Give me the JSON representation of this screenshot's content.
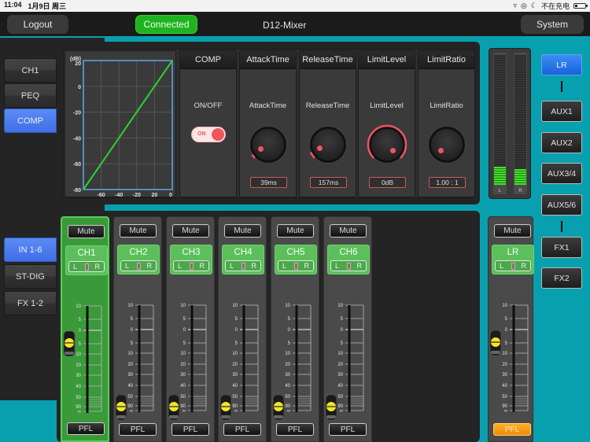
{
  "status_bar": {
    "time": "11:04",
    "date": "1月9日 周三",
    "charging": "不在充电",
    "icons": [
      "wifi-icon",
      "orientation-lock-icon",
      "moon-icon",
      "battery-icon"
    ]
  },
  "header": {
    "logout": "Logout",
    "connection": "Connected",
    "title": "D12-Mixer",
    "system": "System"
  },
  "colors": {
    "accent_teal": "#08a0ae",
    "connected_green": "#1fb41f",
    "active_blue": "#3f6fe5",
    "knob_red": "#f0545f",
    "pfl_orange": "#f08a00"
  },
  "top_tabs": [
    {
      "label": "CH1",
      "active": false
    },
    {
      "label": "PEQ",
      "active": false
    },
    {
      "label": "COMP",
      "active": true
    }
  ],
  "bottom_tabs": [
    {
      "label": "IN 1-6",
      "active": true
    },
    {
      "label": "ST-DIG",
      "active": false
    },
    {
      "label": "FX 1-2",
      "active": false
    }
  ],
  "comp_graph": {
    "unit": "(dB)",
    "y_ticks": [
      "20",
      "0",
      "-20",
      "-40",
      "-60",
      "-80"
    ],
    "x_ticks": [
      "-60",
      "-40",
      "-20",
      "20",
      "0"
    ],
    "curve": "linear-1:1"
  },
  "comp": {
    "header": "COMP",
    "onoff_label": "ON/OFF",
    "toggle_text": "ON",
    "toggle_on": true,
    "params": [
      {
        "header": "AttackTime",
        "label": "AttackTime",
        "value": "39ms",
        "fraction": 0.05
      },
      {
        "header": "ReleaseTime",
        "label": "ReleaseTime",
        "value": "157ms",
        "fraction": 0.08
      },
      {
        "header": "LimitLevel",
        "label": "LimitLevel",
        "value": "0dB",
        "fraction": 1.0
      },
      {
        "header": "LimitRatio",
        "label": "LimitRatio",
        "value": "1.00 : 1",
        "fraction": 0.0
      }
    ]
  },
  "meters": {
    "left_label": "L",
    "right_label": "R",
    "left_level": 0.14,
    "right_level": 0.12
  },
  "buses": [
    {
      "label": "LR",
      "active": true
    },
    {
      "label": "AUX1"
    },
    {
      "label": "AUX2"
    },
    {
      "label": "AUX3/4"
    },
    {
      "label": "AUX5/6"
    },
    {
      "label": "FX1"
    },
    {
      "label": "FX2"
    }
  ],
  "fader_scale": [
    "10",
    "5",
    "0",
    "5",
    "10",
    "20",
    "30",
    "40",
    "50",
    "90",
    "∞"
  ],
  "channels": [
    {
      "name": "CH1",
      "mute": "Mute",
      "pfl": "PFL",
      "pan_l": "L",
      "pan_r": "R",
      "fader_db": "5",
      "selected": true,
      "pfl_on": false
    },
    {
      "name": "CH2",
      "mute": "Mute",
      "pfl": "PFL",
      "pan_l": "L",
      "pan_r": "R",
      "fader_db": "-∞",
      "selected": false,
      "pfl_on": false
    },
    {
      "name": "CH3",
      "mute": "Mute",
      "pfl": "PFL",
      "pan_l": "L",
      "pan_r": "R",
      "fader_db": "-∞",
      "selected": false,
      "pfl_on": false
    },
    {
      "name": "CH4",
      "mute": "Mute",
      "pfl": "PFL",
      "pan_l": "L",
      "pan_r": "R",
      "fader_db": "-∞",
      "selected": false,
      "pfl_on": false
    },
    {
      "name": "CH5",
      "mute": "Mute",
      "pfl": "PFL",
      "pan_l": "L",
      "pan_r": "R",
      "fader_db": "-∞",
      "selected": false,
      "pfl_on": false
    },
    {
      "name": "CH6",
      "mute": "Mute",
      "pfl": "PFL",
      "pan_l": "L",
      "pan_r": "R",
      "fader_db": "-∞",
      "selected": false,
      "pfl_on": false
    }
  ],
  "master": {
    "name": "LR",
    "mute": "Mute",
    "pfl": "PFL",
    "pan_l": "L",
    "pan_r": "R",
    "fader_db": "5",
    "pfl_on": true
  }
}
